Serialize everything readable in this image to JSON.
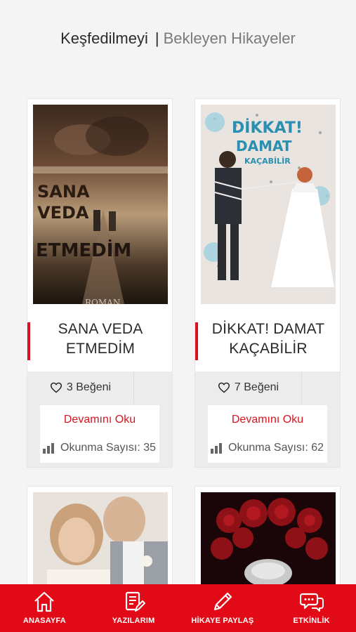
{
  "header": {
    "tab_active": "Keşfedilmeyi",
    "separator": "|",
    "tab_inactive": "Bekleyen Hikayeler"
  },
  "stories": [
    {
      "cover_text_lines": [
        "SANA",
        "VEDA",
        "ETMEDİM",
        "ROMAN"
      ],
      "title": "SANA VEDA ETMEDİM",
      "likes": "3 Beğeni",
      "read_more": "Devamını Oku",
      "reads": "Okunma Sayısı: 35"
    },
    {
      "cover_text_lines": [
        "DİKKAT!",
        "DAMAT",
        "KAÇABİLİR"
      ],
      "title": "DİKKAT! DAMAT KAÇABİLİR",
      "likes": "7 Beğeni",
      "read_more": "Devamını Oku",
      "reads": "Okunma Sayısı: 62"
    },
    {
      "cover_text_lines": []
    },
    {
      "cover_text_lines": []
    }
  ],
  "tabbar": {
    "items": [
      {
        "label": "ANASAYFA",
        "icon": "home-icon"
      },
      {
        "label": "YAZILARIM",
        "icon": "document-edit-icon"
      },
      {
        "label": "HİKAYE PAYLAŞ",
        "icon": "pencil-icon"
      },
      {
        "label": "ETKİNLİK",
        "icon": "chat-bubbles-icon"
      }
    ]
  },
  "colors": {
    "accent": "#d7141f",
    "tabbar_bg": "#e10a16",
    "page_bg": "#f4f4f4"
  }
}
